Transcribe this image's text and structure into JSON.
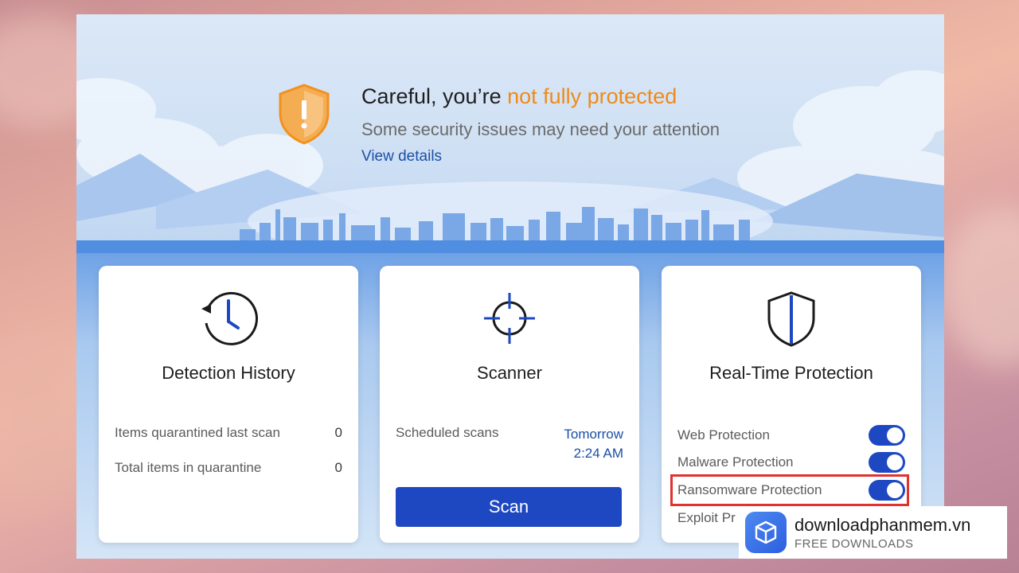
{
  "status": {
    "headline_prefix": "Careful, you’re",
    "headline_warning": "not fully protected",
    "subtitle": "Some security issues may need your attention",
    "details_link": "View details",
    "warning_color": "#ef8a17"
  },
  "cards": {
    "detection_history": {
      "title": "Detection History",
      "icon": "clock-history-icon",
      "rows": [
        {
          "label": "Items quarantined last scan",
          "value": "0"
        },
        {
          "label": "Total items in quarantine",
          "value": "0"
        }
      ]
    },
    "scanner": {
      "title": "Scanner",
      "icon": "crosshair-icon",
      "scheduled_label": "Scheduled scans",
      "scheduled_day": "Tomorrow",
      "scheduled_time": "2:24 AM",
      "scan_button": "Scan"
    },
    "realtime": {
      "title": "Real-Time Protection",
      "icon": "shield-icon",
      "items": [
        {
          "label": "Web Protection",
          "enabled": true
        },
        {
          "label": "Malware Protection",
          "enabled": true
        },
        {
          "label": "Ransomware Protection",
          "enabled": true
        },
        {
          "label": "Exploit Pr",
          "enabled": true
        }
      ]
    }
  },
  "watermark": {
    "name": "downloadphanmem.vn",
    "tagline": "FREE DOWNLOADS",
    "icon": "cube-icon"
  },
  "colors": {
    "accent": "#1d48c2",
    "link": "#1b4fa6",
    "highlight": "#e0322f"
  }
}
